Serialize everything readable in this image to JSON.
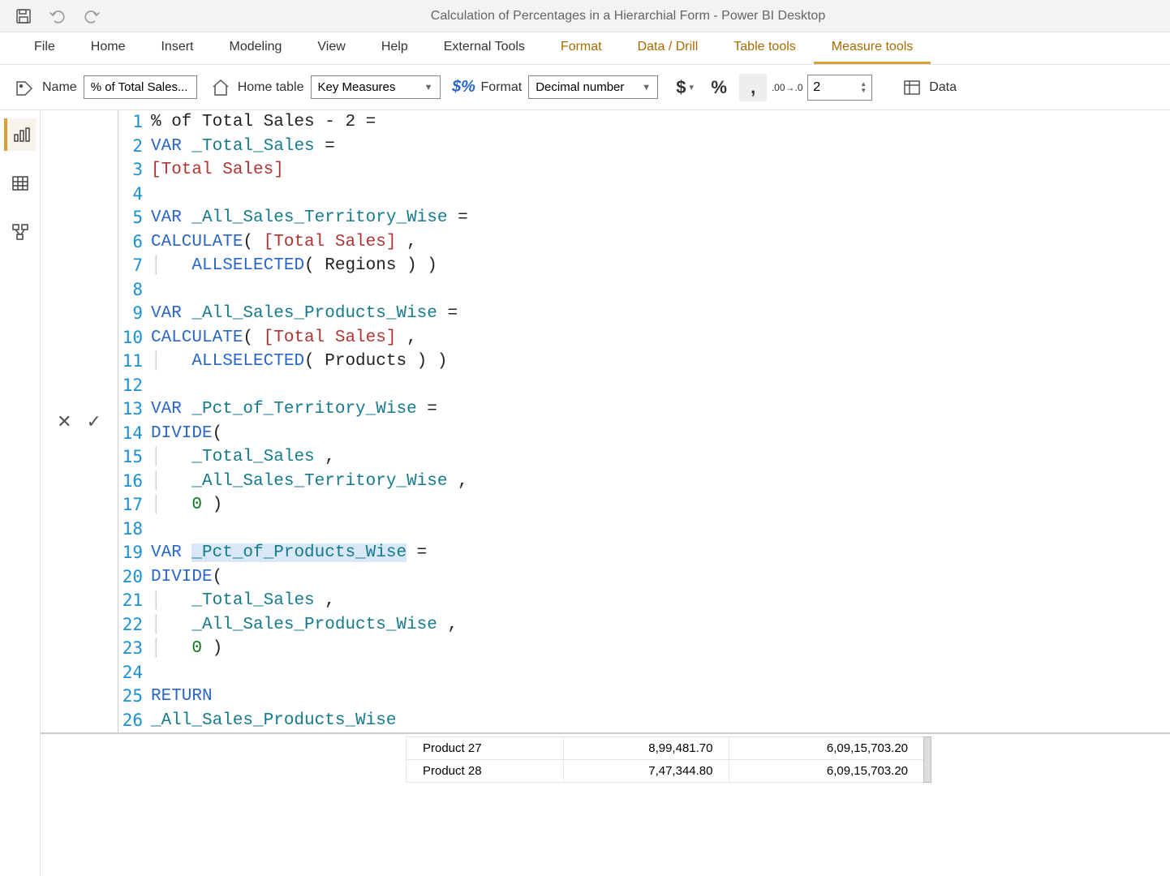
{
  "titlebar": {
    "title": "Calculation of Percentages in a Hierarchial Form - Power BI Desktop"
  },
  "ribbon": {
    "tabs": [
      "File",
      "Home",
      "Insert",
      "Modeling",
      "View",
      "Help",
      "External Tools",
      "Format",
      "Data / Drill",
      "Table tools",
      "Measure tools"
    ],
    "active_tab": "Measure tools",
    "contextual_start": 7,
    "name_label": "Name",
    "name_value": "% of Total Sales...",
    "home_table_label": "Home table",
    "home_table_value": "Key Measures",
    "format_label": "Format",
    "format_value": "Decimal number",
    "decimals_value": "2",
    "data_label": "Data"
  },
  "code": {
    "lines": [
      [
        {
          "t": "plain",
          "v": "% of Total Sales - 2 = "
        }
      ],
      [
        {
          "t": "kw",
          "v": "VAR "
        },
        {
          "t": "var",
          "v": "_Total_Sales"
        },
        {
          "t": "plain",
          "v": " = "
        }
      ],
      [
        {
          "t": "measure",
          "v": "[Total Sales]"
        }
      ],
      [],
      [
        {
          "t": "kw",
          "v": "VAR "
        },
        {
          "t": "var",
          "v": "_All_Sales_Territory_Wise"
        },
        {
          "t": "plain",
          "v": " = "
        }
      ],
      [
        {
          "t": "fn",
          "v": "CALCULATE"
        },
        {
          "t": "plain",
          "v": "( "
        },
        {
          "t": "measure",
          "v": "[Total Sales]"
        },
        {
          "t": "plain",
          "v": " , "
        }
      ],
      [
        {
          "t": "guide",
          "v": "│   "
        },
        {
          "t": "fn",
          "v": "ALLSELECTED"
        },
        {
          "t": "plain",
          "v": "( Regions ) )"
        }
      ],
      [],
      [
        {
          "t": "kw",
          "v": "VAR "
        },
        {
          "t": "var",
          "v": "_All_Sales_Products_Wise"
        },
        {
          "t": "plain",
          "v": " = "
        }
      ],
      [
        {
          "t": "fn",
          "v": "CALCULATE"
        },
        {
          "t": "plain",
          "v": "( "
        },
        {
          "t": "measure",
          "v": "[Total Sales]"
        },
        {
          "t": "plain",
          "v": " , "
        }
      ],
      [
        {
          "t": "guide",
          "v": "│   "
        },
        {
          "t": "fn",
          "v": "ALLSELECTED"
        },
        {
          "t": "plain",
          "v": "( Products ) )"
        }
      ],
      [],
      [
        {
          "t": "kw",
          "v": "VAR "
        },
        {
          "t": "var",
          "v": "_Pct_of_Territory_Wise"
        },
        {
          "t": "plain",
          "v": " = "
        }
      ],
      [
        {
          "t": "fn",
          "v": "DIVIDE"
        },
        {
          "t": "plain",
          "v": "("
        }
      ],
      [
        {
          "t": "guide",
          "v": "│   "
        },
        {
          "t": "var",
          "v": "_Total_Sales"
        },
        {
          "t": "plain",
          "v": " , "
        }
      ],
      [
        {
          "t": "guide",
          "v": "│   "
        },
        {
          "t": "var",
          "v": "_All_Sales_Territory_Wise"
        },
        {
          "t": "plain",
          "v": " , "
        }
      ],
      [
        {
          "t": "guide",
          "v": "│   "
        },
        {
          "t": "num",
          "v": "0"
        },
        {
          "t": "plain",
          "v": " )"
        }
      ],
      [],
      [
        {
          "t": "kw",
          "v": "VAR "
        },
        {
          "t": "var hl",
          "v": "_Pct_of_Products_Wise"
        },
        {
          "t": "plain",
          "v": " = "
        }
      ],
      [
        {
          "t": "fn",
          "v": "DIVIDE"
        },
        {
          "t": "plain",
          "v": "("
        }
      ],
      [
        {
          "t": "guide",
          "v": "│   "
        },
        {
          "t": "var",
          "v": "_Total_Sales"
        },
        {
          "t": "plain",
          "v": " , "
        }
      ],
      [
        {
          "t": "guide",
          "v": "│   "
        },
        {
          "t": "var",
          "v": "_All_Sales_Products_Wise"
        },
        {
          "t": "plain",
          "v": " , "
        }
      ],
      [
        {
          "t": "guide",
          "v": "│   "
        },
        {
          "t": "num",
          "v": "0"
        },
        {
          "t": "plain",
          "v": " )"
        }
      ],
      [],
      [
        {
          "t": "kw",
          "v": "RETURN"
        }
      ],
      [
        {
          "t": "var",
          "v": "_All_Sales_Products_Wise"
        }
      ]
    ]
  },
  "table": {
    "rows": [
      {
        "product": "Product 27",
        "v1": "8,99,481.70",
        "v2": "6,09,15,703.20"
      },
      {
        "product": "Product 28",
        "v1": "7,47,344.80",
        "v2": "6,09,15,703.20"
      }
    ]
  }
}
